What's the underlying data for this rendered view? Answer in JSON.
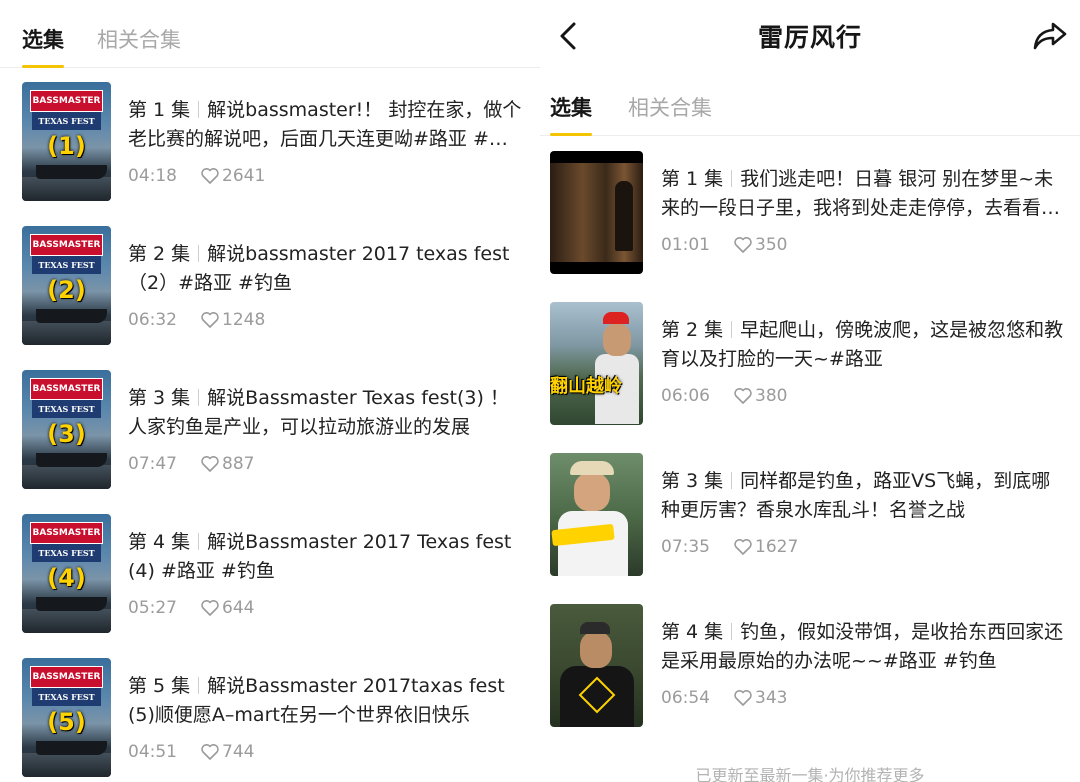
{
  "left": {
    "tabs": [
      {
        "label": "选集",
        "active": true
      },
      {
        "label": "相关合集",
        "active": false
      }
    ],
    "episodes": [
      {
        "num": "第 1 集",
        "title": "解说bassmaster!！ 封控在家，做个老比赛的解说吧，后面几天连更呦#路亚 #钓鱼",
        "duration": "04:18",
        "likes": "2641",
        "thumb_label": "(1)"
      },
      {
        "num": "第 2 集",
        "title": "解说bassmaster 2017 texas fest（2）#路亚 #钓鱼",
        "duration": "06:32",
        "likes": "1248",
        "thumb_label": "(2)"
      },
      {
        "num": "第 3 集",
        "title": "解说Bassmaster Texas fest(3) ！人家钓鱼是产业，可以拉动旅游业的发展",
        "duration": "07:47",
        "likes": "887",
        "thumb_label": "(3)"
      },
      {
        "num": "第 4 集",
        "title": "解说Bassmaster 2017 Texas fest(4) #路亚 #钓鱼",
        "duration": "05:27",
        "likes": "644",
        "thumb_label": "(4)"
      },
      {
        "num": "第 5 集",
        "title": "解说Bassmaster 2017taxas fest(5)顺便愿A–mart在另一个世界依旧快乐",
        "duration": "04:51",
        "likes": "744",
        "thumb_label": "(5)"
      }
    ],
    "thumb_logo": "BASSMASTER",
    "thumb_sub": "TEXAS FEST"
  },
  "right": {
    "title": "雷厉风行",
    "tabs": [
      {
        "label": "选集",
        "active": true
      },
      {
        "label": "相关合集",
        "active": false
      }
    ],
    "episodes": [
      {
        "num": "第 1 集",
        "title": "我们逃走吧！日暮 银河 别在梦里~未来的一段日子里，我将到处走走停停，去看看这个世界",
        "duration": "01:01",
        "likes": "350"
      },
      {
        "num": "第 2 集",
        "title": "早起爬山，傍晚波爬，这是被忽悠和教育以及打脸的一天~#路亚",
        "duration": "06:06",
        "likes": "380",
        "thumb_caption": "翻山越岭"
      },
      {
        "num": "第 3 集",
        "title": "同样都是钓鱼，路亚VS飞蝇，到底哪种更厉害？香泉水库乱斗！名誉之战",
        "duration": "07:35",
        "likes": "1627"
      },
      {
        "num": "第 4 集",
        "title": "钓鱼，假如没带饵，是收拾东西回家还是采用最原始的办法呢~~#路亚 #钓鱼",
        "duration": "06:54",
        "likes": "343"
      }
    ],
    "footer_note": "已更新至最新一集·为你推荐更多"
  },
  "colors": {
    "accent": "#f5c400",
    "text": "#222222",
    "muted": "#9b9b9b"
  }
}
